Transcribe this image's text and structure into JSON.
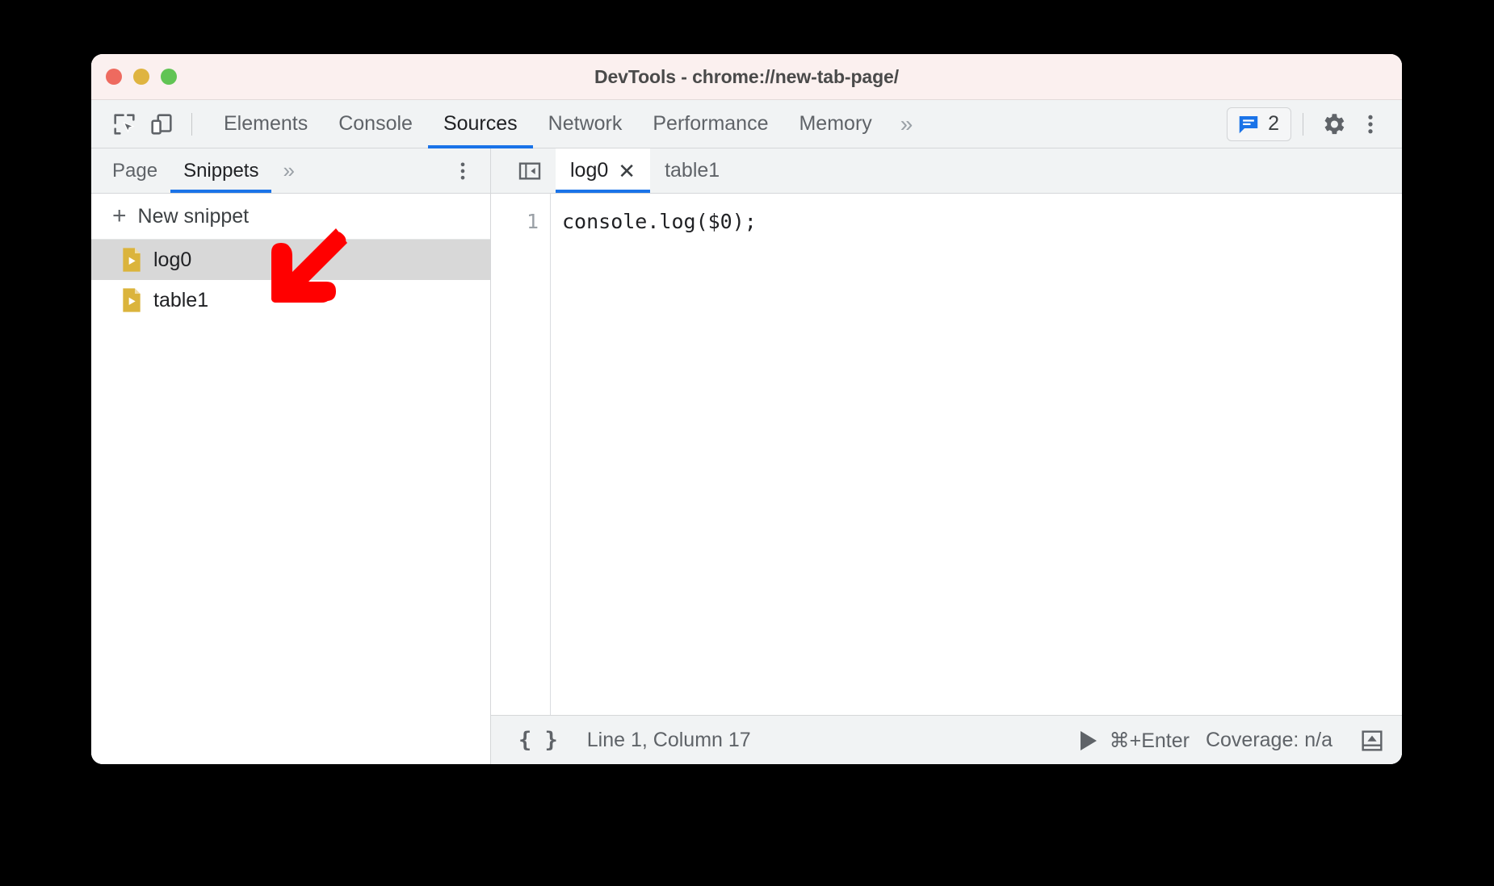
{
  "window": {
    "title": "DevTools - chrome://new-tab-page/",
    "traffic_lights": {
      "close": "close-window-button",
      "minimize": "minimize-window-button",
      "maximize": "maximize-window-button"
    }
  },
  "toolbar": {
    "inspect_icon": "inspect-element-icon",
    "device_icon": "device-toolbar-icon",
    "tabs": [
      {
        "label": "Elements",
        "active": false
      },
      {
        "label": "Console",
        "active": false
      },
      {
        "label": "Sources",
        "active": true
      },
      {
        "label": "Network",
        "active": false
      },
      {
        "label": "Performance",
        "active": false
      },
      {
        "label": "Memory",
        "active": false
      }
    ],
    "more_tabs": "»",
    "message_badge": {
      "icon": "message-bubble-icon",
      "count": "2"
    },
    "settings_icon": "gear-icon",
    "menu_icon": "three-dot-menu-icon"
  },
  "navigator": {
    "tabs": [
      {
        "label": "Page",
        "active": false
      },
      {
        "label": "Snippets",
        "active": true
      }
    ],
    "more_tabs": "»",
    "menu_icon": "three-dot-menu-icon",
    "new_snippet": {
      "plus": "+",
      "label": "New snippet"
    },
    "snippets": [
      {
        "name": "log0",
        "selected": true,
        "icon": "snippet-script-icon"
      },
      {
        "name": "table1",
        "selected": false,
        "icon": "snippet-script-icon"
      }
    ]
  },
  "editor": {
    "collapse_icon": "collapse-sidebar-icon",
    "tabs": [
      {
        "label": "log0",
        "active": true,
        "closable": true,
        "close_glyph": "✕"
      },
      {
        "label": "table1",
        "active": false,
        "closable": false,
        "close_glyph": ""
      }
    ],
    "lines": [
      {
        "number": "1",
        "text": "console.log($0);"
      }
    ]
  },
  "status_bar": {
    "pretty_print": "{ }",
    "cursor_position": "Line 1, Column 17",
    "run_shortcut": "⌘+Enter",
    "run_icon": "play-icon",
    "coverage": "Coverage: n/a",
    "drawer_icon": "show-drawer-icon"
  },
  "annotation": {
    "arrow": "red-arrow-pointing-to-log0-snippet",
    "color": "#ff0000"
  },
  "colors": {
    "accent": "#1a73e8",
    "titlebar_bg": "#fbf0ef",
    "toolbar_bg": "#f1f3f4",
    "snippet_icon": "#dbb43c",
    "selection_bg": "#d8d8d8"
  }
}
